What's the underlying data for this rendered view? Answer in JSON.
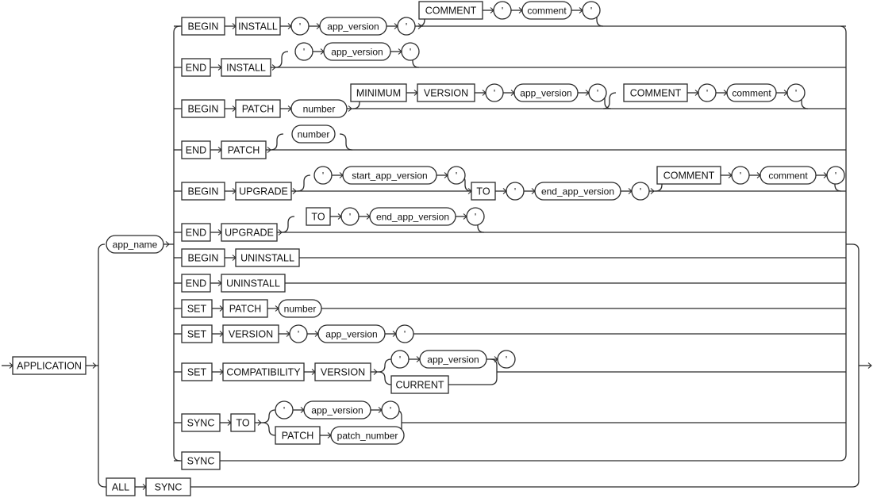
{
  "diagram": {
    "type": "railroad-syntax-diagram",
    "start": {
      "label": "APPLICATION"
    },
    "app_name": {
      "label": "app_name"
    },
    "rows": [
      {
        "name": "begin-install",
        "items": [
          "BEGIN",
          "INSTALL",
          "'",
          "app_version",
          "'"
        ],
        "optional": [
          "COMMENT",
          "'",
          "comment",
          "'"
        ]
      },
      {
        "name": "end-install",
        "items": [
          "END",
          "INSTALL"
        ],
        "optional": [
          "'",
          "app_version",
          "'"
        ]
      },
      {
        "name": "begin-patch",
        "items": [
          "BEGIN",
          "PATCH",
          "number"
        ],
        "optional": [
          "MINIMUM",
          "VERSION",
          "'",
          "app_version",
          "'"
        ],
        "optional2": [
          "COMMENT",
          "'",
          "comment",
          "'"
        ]
      },
      {
        "name": "end-patch",
        "items": [
          "END",
          "PATCH"
        ],
        "optional": [
          "number"
        ]
      },
      {
        "name": "begin-upgrade",
        "items": [
          "BEGIN",
          "UPGRADE"
        ],
        "optional": [
          "'",
          "start_app_version",
          "'"
        ],
        "after": [
          "TO",
          "'",
          "end_app_version",
          "'"
        ],
        "optional2": [
          "COMMENT",
          "'",
          "comment",
          "'"
        ]
      },
      {
        "name": "end-upgrade",
        "items": [
          "END",
          "UPGRADE"
        ],
        "optional": [
          "TO",
          "'",
          "end_app_version",
          "'"
        ]
      },
      {
        "name": "begin-uninstall",
        "items": [
          "BEGIN",
          "UNINSTALL"
        ]
      },
      {
        "name": "end-uninstall",
        "items": [
          "END",
          "UNINSTALL"
        ]
      },
      {
        "name": "set-patch",
        "items": [
          "SET",
          "PATCH",
          "number"
        ]
      },
      {
        "name": "set-version",
        "items": [
          "SET",
          "VERSION",
          "'",
          "app_version",
          "'"
        ]
      },
      {
        "name": "set-compatibility-version",
        "items": [
          "SET",
          "COMPATIBILITY",
          "VERSION"
        ],
        "choice_a": [
          "'",
          "app_version",
          "'"
        ],
        "choice_b": [
          "CURRENT"
        ]
      },
      {
        "name": "sync-to",
        "items": [
          "SYNC",
          "TO"
        ],
        "choice_a": [
          "'",
          "app_version",
          "'"
        ],
        "choice_b": [
          "PATCH",
          "patch_number"
        ]
      },
      {
        "name": "sync",
        "items": [
          "SYNC"
        ]
      }
    ],
    "all_sync": {
      "items": [
        "ALL",
        "SYNC"
      ]
    }
  }
}
